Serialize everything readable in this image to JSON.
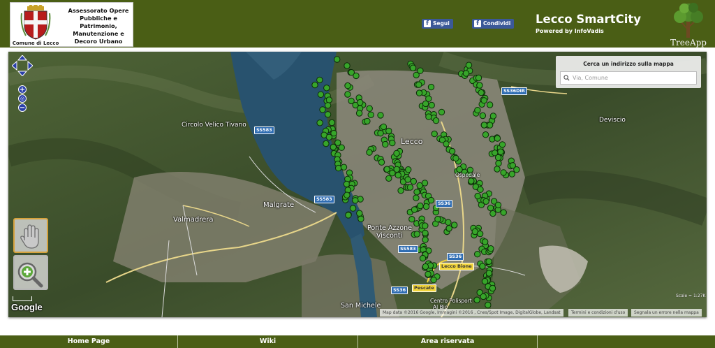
{
  "header": {
    "crest_caption": "Comune di Lecco",
    "dept_lines": [
      "Assessorato Opere",
      "Pubbliche e",
      "Patrimonio,",
      "Manutenzione e",
      "Decoro Urbano"
    ],
    "fb_follow": "Segui",
    "fb_share": "Condividi",
    "title": "Lecco SmartCity",
    "subtitle": "Powered by InfoVadis",
    "app_name": "TreeApp"
  },
  "search": {
    "title": "Cerca un indirizzo sulla mappa",
    "placeholder": "Via, Comune"
  },
  "map": {
    "place_labels": [
      {
        "id": "circolo",
        "text": "Circolo Velico Tivano"
      },
      {
        "id": "lecco",
        "text": "Lecco"
      },
      {
        "id": "malgrate",
        "text": "Malgrate"
      },
      {
        "id": "valmadrera",
        "text": "Valmadrera"
      },
      {
        "id": "ponte-azzone",
        "text": "Ponte Azzone"
      },
      {
        "id": "visconti",
        "text": "Visconti"
      },
      {
        "id": "san-michele",
        "text": "San Michele"
      },
      {
        "id": "deviscio",
        "text": "Deviscio"
      },
      {
        "id": "ospedale",
        "text": "Ospedale"
      },
      {
        "id": "centro",
        "text": "Centro Polisport"
      },
      {
        "id": "al-bio",
        "text": "Al Bio"
      }
    ],
    "road_labels": [
      {
        "id": "ss583-a",
        "text": "SS583"
      },
      {
        "id": "ss583-b",
        "text": "SS583"
      },
      {
        "id": "ss583-c",
        "text": "SS583"
      },
      {
        "id": "ss36-a",
        "text": "SS36"
      },
      {
        "id": "ss36-b",
        "text": "SS36"
      },
      {
        "id": "ss36-c",
        "text": "SS36"
      },
      {
        "id": "ss36dir",
        "text": "SS36DIR"
      },
      {
        "id": "pescate",
        "text": "Pescate"
      },
      {
        "id": "lecco-bione",
        "text": "Lecco Bione"
      }
    ],
    "google": "Google",
    "attribution": "Map data ©2016 Google, Immagini ©2016 , Cnes/Spot Image, DigitalGlobe, Landsat",
    "terms": "Termini e condizioni d'uso",
    "report": "Segnala un errore nella mappa",
    "scale_right": "Scale = 1:27K"
  },
  "footer": {
    "items": [
      "Home Page",
      "Wiki",
      "Area riservata",
      ""
    ]
  },
  "colors": {
    "brand_green": "#4a5e15",
    "facebook_blue": "#3b5998",
    "tree_marker": "#37a52a"
  }
}
